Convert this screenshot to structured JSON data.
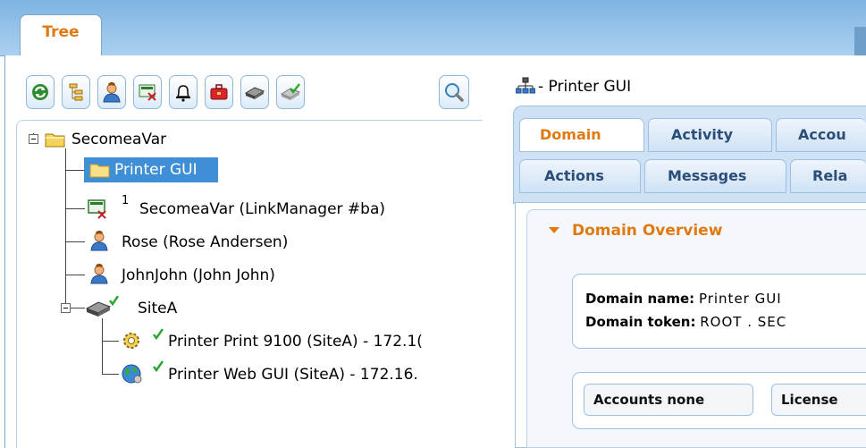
{
  "top_tab": {
    "label": "Tree"
  },
  "toolbar": {
    "buttons": [
      "refresh-icon",
      "tree-view-icon",
      "user-icon",
      "linkmanager-icon",
      "alarm-bell-icon",
      "toolbox-icon",
      "site-device-icon",
      "site-device-check-icon"
    ],
    "search_icon": "magnifier-icon"
  },
  "tree": {
    "root": {
      "label": "SecomeaVar"
    },
    "items": [
      {
        "label": "Printer GUI",
        "selected": true
      },
      {
        "label": "SecomeaVar (LinkManager #ba)",
        "badge": "1"
      },
      {
        "label": "Rose (Rose Andersen)"
      },
      {
        "label": "JohnJohn (John John)"
      },
      {
        "label": "SiteA"
      }
    ],
    "site_children": [
      {
        "label": "Printer Print 9100 (SiteA) - 172.1("
      },
      {
        "label": "Printer Web GUI (SiteA) - 172.16."
      }
    ]
  },
  "node_header": {
    "label": "- Printer GUI"
  },
  "tabs": {
    "row1": [
      "Domain",
      "Activity",
      "Accou"
    ],
    "row2": [
      "Actions",
      "Messages",
      "Rela"
    ],
    "active": "Domain"
  },
  "overview": {
    "title": "Domain Overview",
    "domain_name_label": "Domain name:",
    "domain_name_value": "Printer GUI",
    "domain_token_label": "Domain token:",
    "domain_token_value": "ROOT . SEC",
    "accounts_label": "Accounts none",
    "license_label": "License"
  },
  "colors": {
    "accent": "#e07a10",
    "selection": "#3f8fd6",
    "tab_text": "#2b4e78",
    "topbar": "#9ec8ec"
  }
}
